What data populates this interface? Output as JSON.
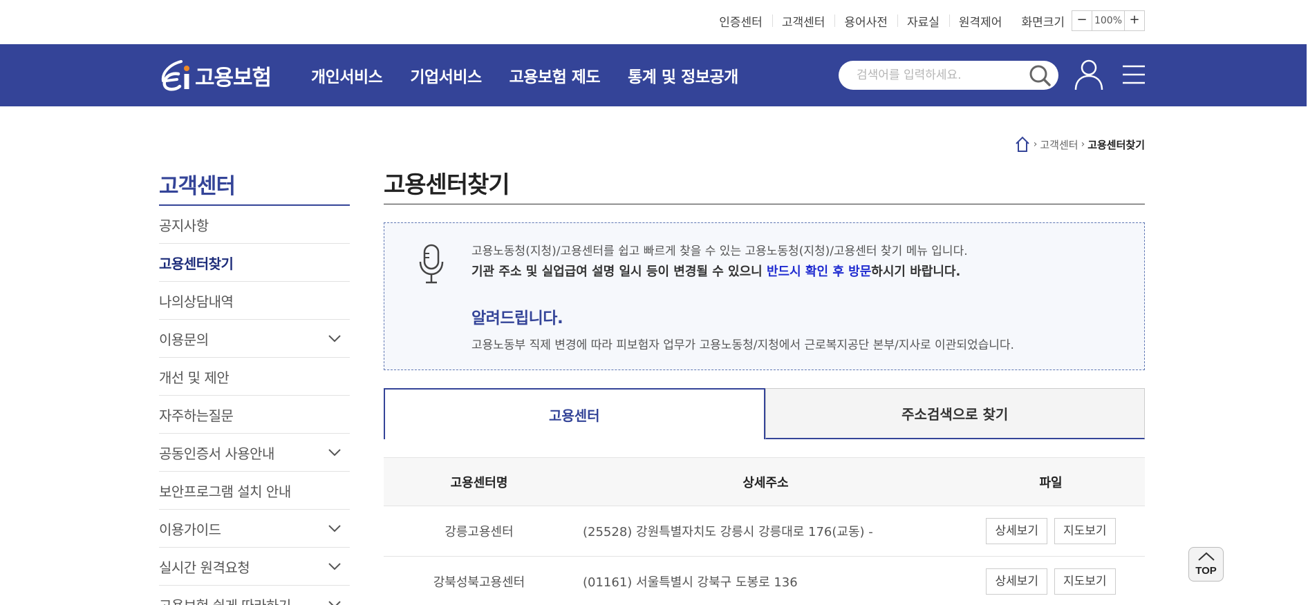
{
  "util": {
    "links": [
      "인증센터",
      "고객센터",
      "용어사전",
      "자료실",
      "원격제어"
    ],
    "zoom_label": "화면크기",
    "zoom_minus": "−",
    "zoom_value": "100%",
    "zoom_plus": "+"
  },
  "gnb": {
    "logo_text": "고용보험",
    "menu": [
      "개인서비스",
      "기업서비스",
      "고용보험 제도",
      "통계 및 정보공개"
    ],
    "search_placeholder": "검색어를 입력하세요."
  },
  "breadcrumb": {
    "items": [
      "고객센터"
    ],
    "current": "고용센터찾기"
  },
  "sidebar": {
    "title": "고객센터",
    "items": [
      {
        "label": "공지사항",
        "expandable": false,
        "active": false
      },
      {
        "label": "고용센터찾기",
        "expandable": false,
        "active": true
      },
      {
        "label": "나의상담내역",
        "expandable": false,
        "active": false
      },
      {
        "label": "이용문의",
        "expandable": true,
        "active": false
      },
      {
        "label": "개선 및 제안",
        "expandable": false,
        "active": false
      },
      {
        "label": "자주하는질문",
        "expandable": false,
        "active": false
      },
      {
        "label": "공동인증서 사용안내",
        "expandable": true,
        "active": false
      },
      {
        "label": "보안프로그램 설치 안내",
        "expandable": false,
        "active": false
      },
      {
        "label": "이용가이드",
        "expandable": true,
        "active": false
      },
      {
        "label": "실시간 원격요청",
        "expandable": true,
        "active": false
      },
      {
        "label": "고용보험 쉽게 따라하기",
        "expandable": true,
        "active": false
      }
    ]
  },
  "content": {
    "title": "고용센터찾기",
    "notice": {
      "line1": "고용노동청(지청)/고용센터를 쉽고 빠르게 찾을 수 있는 고용노동청(지청)/고용센터 찾기 메뉴 입니다.",
      "line2_pre": "기관 주소 및 실업급여 설명 일시 등이 변경될 수 있으니 ",
      "line2_highlight": "반드시 확인 후 방문",
      "line2_post": "하시기 바랍니다.",
      "heading": "알려드립니다.",
      "line3": "고용노동부 직제 변경에 따라 피보험자 업무가 고용노동청/지청에서 근로복지공단 본부/지사로 이관되었습니다."
    },
    "tabs": [
      "고용센터",
      "주소검색으로 찾기"
    ],
    "table": {
      "headers": [
        "고용센터명",
        "상세주소",
        "파일"
      ],
      "rows": [
        {
          "name": "강릉고용센터",
          "address": "(25528) 강원특별자치도 강릉시 강릉대로 176(교동) -",
          "btn_detail": "상세보기",
          "btn_map": "지도보기"
        },
        {
          "name": "강북성북고용센터",
          "address": "(01161) 서울특별시 강북구 도봉로 136",
          "btn_detail": "상세보기",
          "btn_map": "지도보기"
        }
      ]
    }
  },
  "top_button": "TOP",
  "colors": {
    "brand": "#344498",
    "highlight": "#1f2bd0"
  }
}
